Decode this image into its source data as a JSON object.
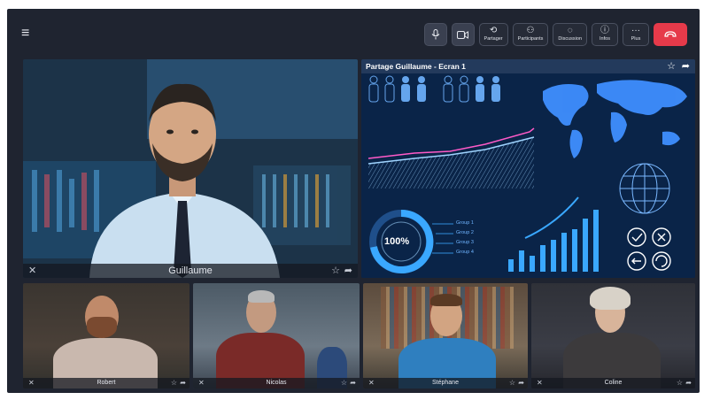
{
  "toolbar": {
    "mic_icon": "microphone-icon",
    "camera_icon": "camera-icon",
    "share_label": "Partager",
    "participants_label": "Participants",
    "discussion_label": "Discussion",
    "infos_label": "Infos",
    "more_label": "Plus",
    "hangup_icon": "phone-hangup-icon"
  },
  "main_tile": {
    "name": "Guillaume"
  },
  "share_tile": {
    "title": "Partage Guillaume - Ecran 1",
    "ring_value": "100%",
    "groups": [
      "Group 1",
      "Group 2",
      "Group 3",
      "Group 4"
    ]
  },
  "participants": [
    {
      "name": "Robert"
    },
    {
      "name": "Nicolas"
    },
    {
      "name": "Stéphane"
    },
    {
      "name": "Coline"
    }
  ],
  "colors": {
    "background": "#1f2430",
    "hangup": "#e63a4a",
    "share_bg": "#0a2448",
    "accent": "#3aa8ff"
  }
}
